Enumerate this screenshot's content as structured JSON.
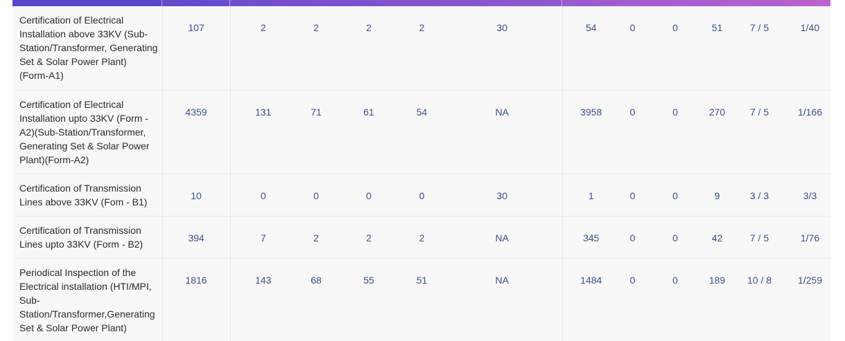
{
  "rows": [
    {
      "description": "Certification of Electrical Installation above 33KV (Sub-Station/Transformer, Generating Set & Solar Power Plant) (Form-A1)",
      "cells": [
        "107",
        "2",
        "2",
        "2",
        "2",
        "30",
        "54",
        "0",
        "0",
        "51",
        "7 / 5",
        "1/40"
      ]
    },
    {
      "description": "Certification of Electrical Installation upto 33KV (Form - A2)(Sub-Station/Transformer, Generating Set & Solar Power Plant)(Form-A2)",
      "cells": [
        "4359",
        "131",
        "71",
        "61",
        "54",
        "NA",
        "3958",
        "0",
        "0",
        "270",
        "7 / 5",
        "1/166"
      ]
    },
    {
      "description": "Certification of Transmission Lines above 33KV (Fom - B1)",
      "cells": [
        "10",
        "0",
        "0",
        "0",
        "0",
        "30",
        "1",
        "0",
        "0",
        "9",
        "3 / 3",
        "3/3"
      ]
    },
    {
      "description": "Certification of Transmission Lines upto 33KV (Form - B2)",
      "cells": [
        "394",
        "7",
        "2",
        "2",
        "2",
        "NA",
        "345",
        "0",
        "0",
        "42",
        "7 / 5",
        "1/76"
      ]
    },
    {
      "description": "Periodical Inspection of the Electrical installation (HTI/MPI, Sub-Station/Transformer,Generating Set & Solar Power Plant)",
      "cells": [
        "1816",
        "143",
        "68",
        "55",
        "51",
        "NA",
        "1484",
        "0",
        "0",
        "189",
        "10 / 8",
        "1/259"
      ]
    }
  ]
}
